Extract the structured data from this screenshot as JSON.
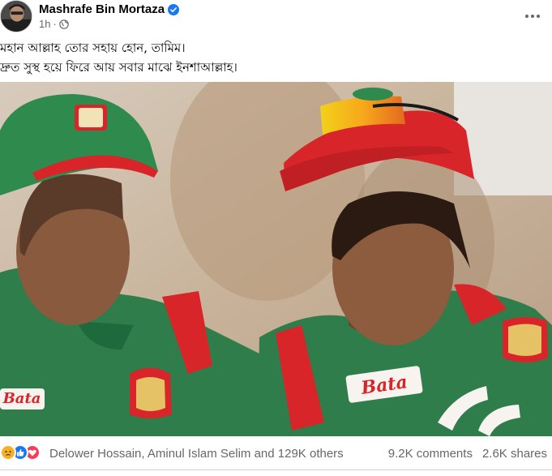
{
  "post": {
    "author": "Mashrafe Bin Mortaza",
    "time": "1h",
    "text_lines": [
      "মহান আল্লাহ তোর সহায় হোন, তামিম।",
      "দ্রুত সুস্থ হয়ে ফিরে আয় সবার মাঝে ইনশাআল্লাহ।"
    ],
    "photo": {
      "left_player_logo_text": "Bata",
      "right_player_logo_text": "Bata"
    }
  },
  "icons": {
    "verified": "verified-badge-icon",
    "audience": "globe-icon",
    "more": "more-options-icon",
    "reactions": [
      "sad-reaction-icon",
      "like-reaction-icon",
      "love-reaction-icon"
    ]
  },
  "footer": {
    "reactors": "Delower Hossain, Aminul Islam Selim and 129K others",
    "comments": "9.2K comments",
    "shares": "2.6K shares"
  },
  "colors": {
    "verified": "#1877f2",
    "meta": "#65676b",
    "jersey_green": "#2f7d4a",
    "jersey_red": "#d8252a"
  }
}
